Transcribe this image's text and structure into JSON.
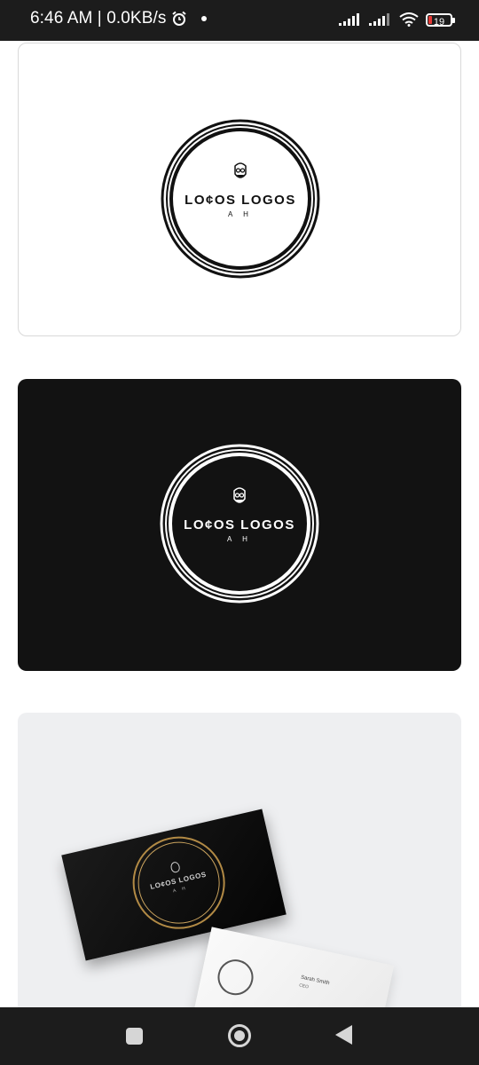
{
  "status_bar": {
    "time_and_speed": "6:46 AM | 0.0KB/s",
    "battery": "19",
    "icons": [
      "alarm-icon",
      "notification-dot-icon",
      "signal-icon",
      "signal-icon",
      "wifi-icon",
      "battery-icon"
    ],
    "battery_low_color": "#e53935"
  },
  "logo": {
    "name": "LO¢OS LOGOS",
    "initials": "A H",
    "icon": "face-glasses-icon"
  },
  "mockup": {
    "person_name": "Sarah Smith",
    "person_title": "CEO"
  },
  "nav_bar": {
    "icons": [
      "recents-square-icon",
      "home-circle-icon",
      "back-triangle-icon"
    ]
  },
  "colors": {
    "status_bar": "#1c1c1c",
    "black_card": "#121212",
    "mock_card": "#eeeff1",
    "gold": "#b28a45"
  }
}
